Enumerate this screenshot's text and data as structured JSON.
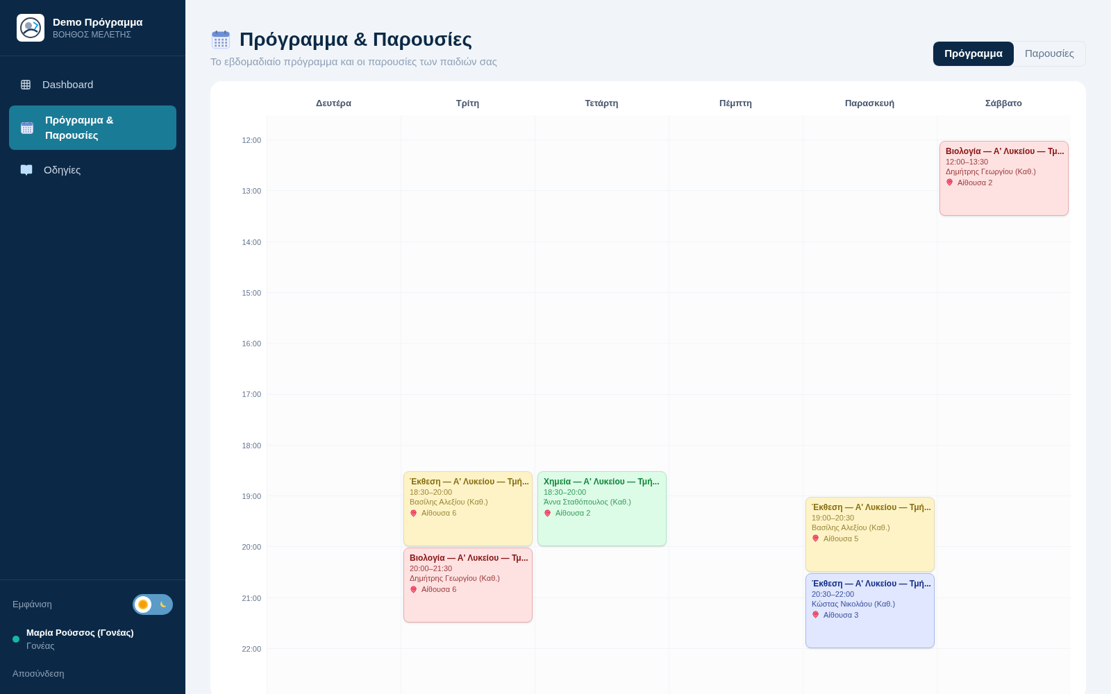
{
  "brand": {
    "title": "Demo Πρόγραμμα",
    "subtitle": "ΒΟΗΘΟΣ ΜΕΛΕΤΗΣ"
  },
  "nav": [
    {
      "label": "Dashboard",
      "kind": "grid",
      "selected": false
    },
    {
      "label": "Πρόγραμμα & Παρουσίες",
      "kind": "calendar",
      "selected": true
    },
    {
      "label": "Οδηγίες",
      "kind": "book",
      "selected": false
    }
  ],
  "appearance": {
    "label": "Εμφάνιση",
    "dark": false
  },
  "user": {
    "name": "Μαρία Ρούσσος (Γονέας)",
    "role": "Γονέας",
    "online": true
  },
  "logout": "Αποσύνδεση",
  "page": {
    "title": "Πρόγραμμα & Παρουσίες",
    "subtitle": "Το εβδομαδιαίο πρόγραμμα και οι παρουσίες των παιδιών σας"
  },
  "tabs": [
    {
      "label": "Πρόγραμμα",
      "selected": true
    },
    {
      "label": "Παρουσίες",
      "selected": false
    }
  ],
  "hours": [
    "12:00",
    "13:00",
    "14:00",
    "15:00",
    "16:00",
    "17:00",
    "18:00",
    "19:00",
    "20:00",
    "21:00",
    "22:00"
  ],
  "days": [
    {
      "label": "Δευτέρα"
    },
    {
      "label": "Τρίτη",
      "events": [
        {
          "title": "Έκθεση — Α' Λυκείου — Τμή...",
          "time": "18:30–20:00",
          "teacher": "Βασίλης Αλεξίου (Καθ.)",
          "room": "Αίθουσα 6",
          "color": "#fef3c7"
        },
        {
          "title": "Βιολογία — Α' Λυκείου — Τμ...",
          "time": "20:00–21:30",
          "teacher": "Δημήτρης Γεωργίου (Καθ.)",
          "room": "Αίθουσα 6",
          "color": "#fee2e2"
        }
      ]
    },
    {
      "label": "Τετάρτη",
      "events": [
        {
          "title": "Χημεία — Α' Λυκείου — Τμή...",
          "time": "18:30–20:00",
          "teacher": "Άννα Σταθόπουλος (Καθ.)",
          "room": "Αίθουσα 2",
          "color": "#dcfce7"
        }
      ]
    },
    {
      "label": "Πέμπτη"
    },
    {
      "label": "Παρασκευή",
      "events": [
        {
          "title": "Έκθεση — Α' Λυκείου — Τμή...",
          "time": "19:00–20:30",
          "teacher": "Βασίλης Αλεξίου (Καθ.)",
          "room": "Αίθουσα 5",
          "color": "#fef3c7"
        },
        {
          "title": "Έκθεση — Α' Λυκείου — Τμή...",
          "time": "20:30–22:00",
          "teacher": "Κώστας Νικολάου (Καθ.)",
          "room": "Αίθουσα 3",
          "color": "#e0e7ff"
        }
      ]
    },
    {
      "label": "Σάββατο",
      "events": [
        {
          "title": "Βιολογία — Α' Λυκείου — Τμ...",
          "time": "12:00–13:30",
          "teacher": "Δημήτρης Γεωργίου (Καθ.)",
          "room": "Αίθουσα 2",
          "color": "#fee2e2"
        }
      ]
    }
  ]
}
